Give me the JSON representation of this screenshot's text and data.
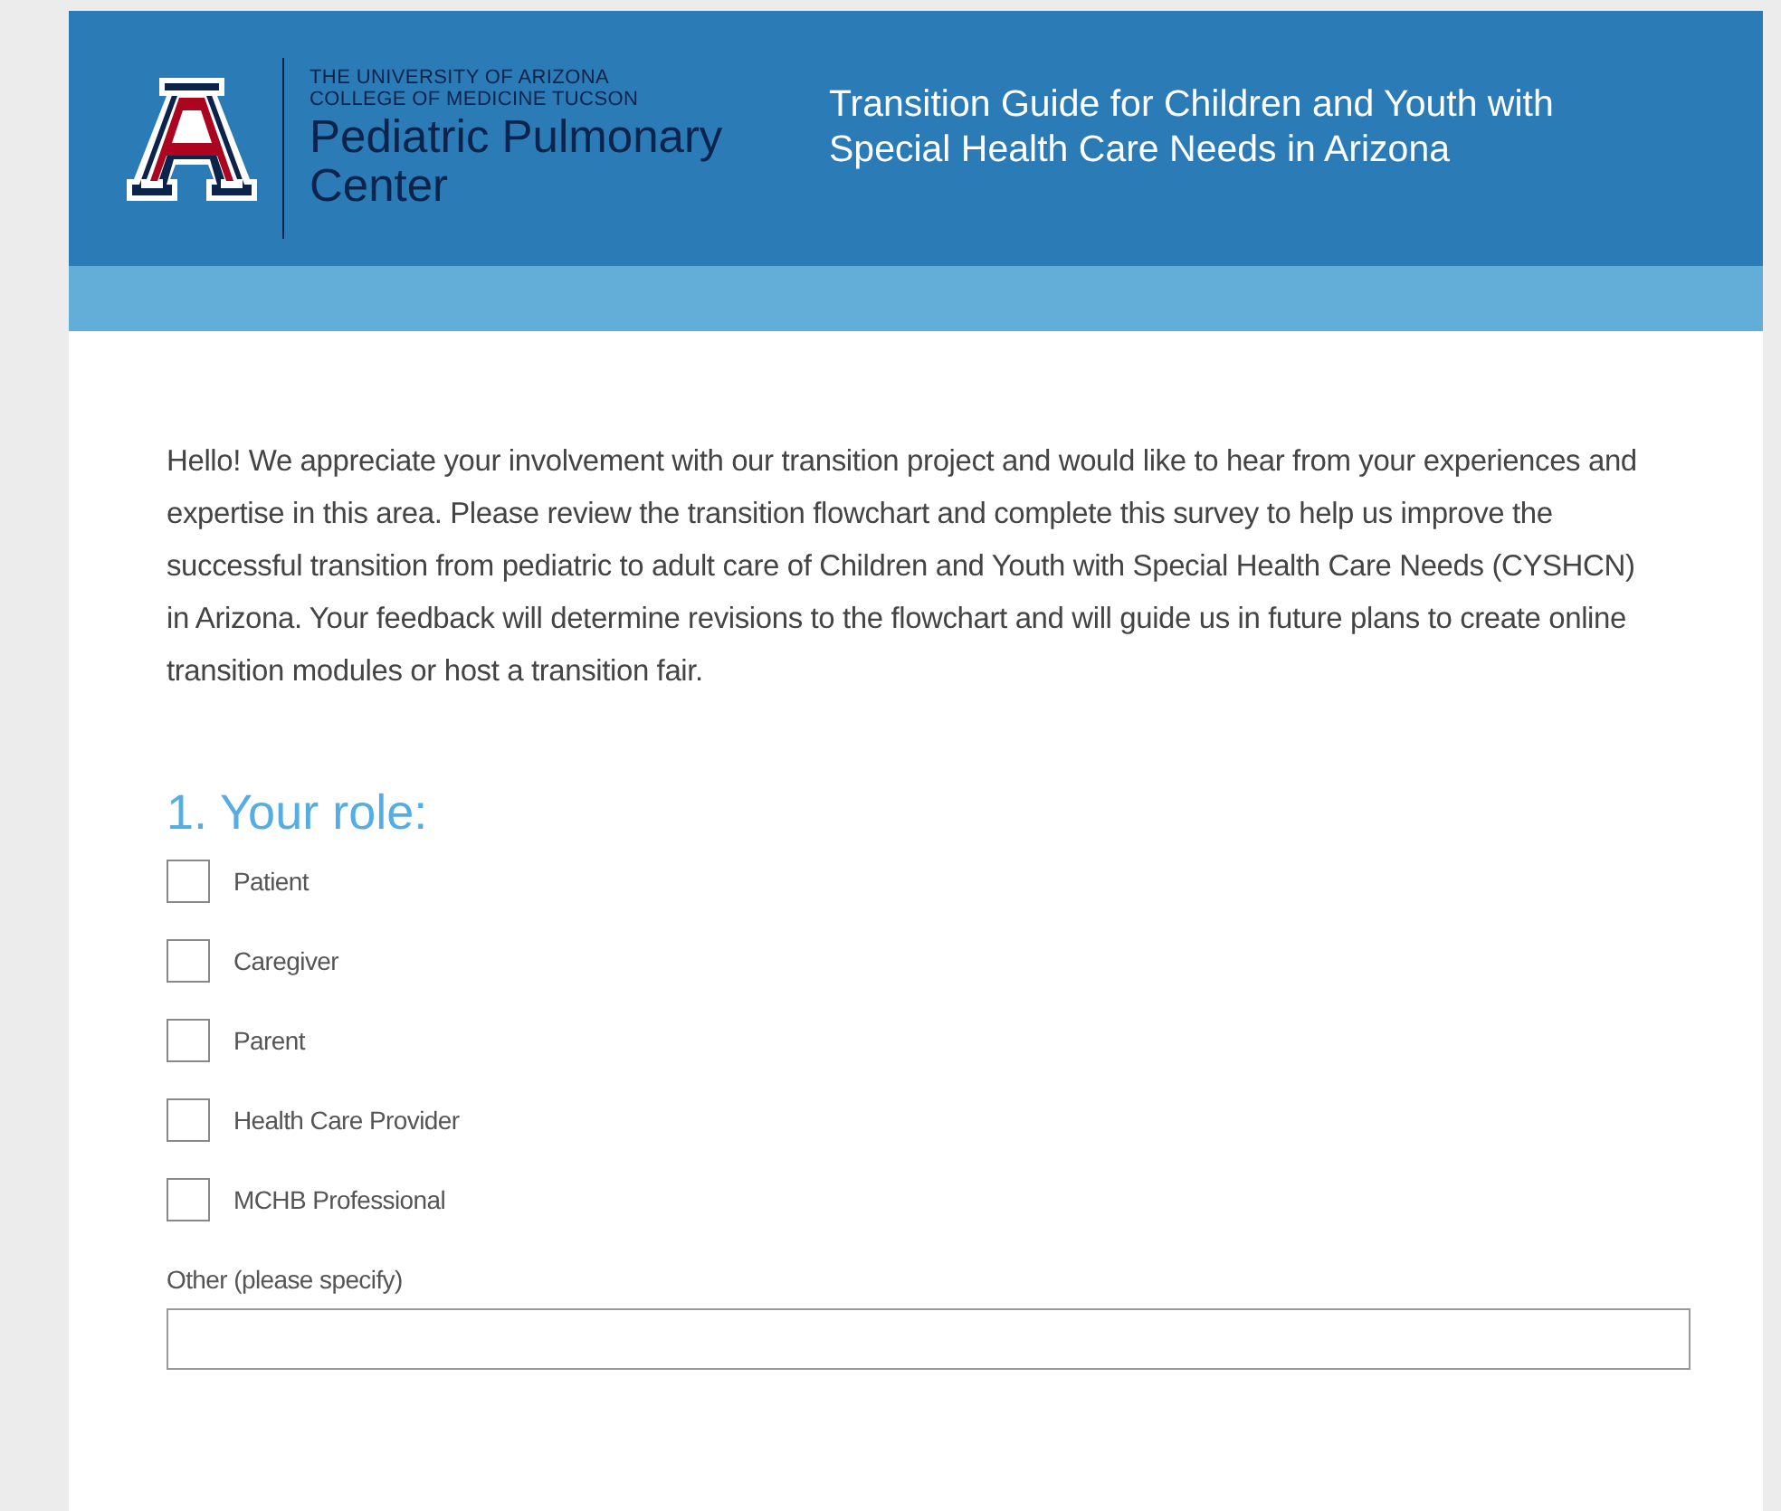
{
  "header": {
    "university": "THE UNIVERSITY OF ARIZONA",
    "college": "COLLEGE OF MEDICINE TUCSON",
    "center": "Pediatric Pulmonary Center",
    "title": "Transition Guide for Children and Youth with Special Health Care Needs in Arizona"
  },
  "intro": "Hello! We appreciate your involvement with our transition project and would like to hear from your experiences and expertise in this area. Please review the transition flowchart and complete this survey to help us improve the successful transition from pediatric to adult care of Children and Youth with Special Health Care Needs (CYSHCN) in Arizona.  Your feedback will determine revisions to the flowchart and will guide us in future plans to create online transition modules or host a transition fair.",
  "question": {
    "title": "1. Your role:",
    "options": [
      {
        "label": "Patient",
        "checked": false
      },
      {
        "label": "Caregiver",
        "checked": false
      },
      {
        "label": "Parent",
        "checked": false
      },
      {
        "label": "Health Care Provider",
        "checked": false
      },
      {
        "label": "MCHB Professional",
        "checked": false
      }
    ],
    "other_label": "Other (please specify)"
  }
}
